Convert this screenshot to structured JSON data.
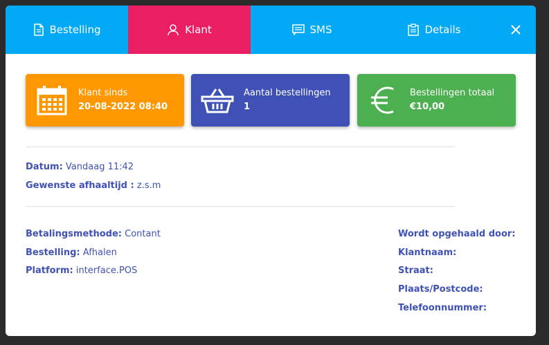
{
  "tabs": [
    {
      "label": "Bestelling",
      "icon": "document-icon"
    },
    {
      "label": "Klant",
      "icon": "user-icon",
      "active": true
    },
    {
      "label": "SMS",
      "icon": "message-icon"
    },
    {
      "label": "Details",
      "icon": "clipboard-icon"
    }
  ],
  "cards": {
    "customer_since": {
      "label": "Klant sinds",
      "value": "20-08-2022 08:40",
      "icon": "calendar-icon",
      "color": "#ff9800"
    },
    "order_count": {
      "label": "Aantal bestellingen",
      "value": "1",
      "icon": "basket-icon",
      "color": "#3f51b5"
    },
    "order_total": {
      "label": "Bestellingen totaal",
      "value": "€10,00",
      "icon": "euro-icon",
      "color": "#4caf50"
    }
  },
  "info": {
    "datum_label": "Datum:",
    "datum_value": "Vandaag 11:42",
    "pickup_label": "Gewenste afhaaltijd :",
    "pickup_value": "z.s.m",
    "payment_label": "Betalingsmethode:",
    "payment_value": "Contant",
    "order_label": "Bestelling:",
    "order_value": "Afhalen",
    "platform_label": "Platform:",
    "platform_value": "interface.POS"
  },
  "pickup_details": {
    "picked_up_by": "Wordt opgehaald door:",
    "customer_name": "Klantnaam:",
    "street": "Straat:",
    "place_postcode": "Plaats/Postcode:",
    "phone": "Telefoonnummer:"
  },
  "colors": {
    "tab_bar": "#03a9f4",
    "active_tab": "#e91e63",
    "text": "#3f51b5"
  }
}
